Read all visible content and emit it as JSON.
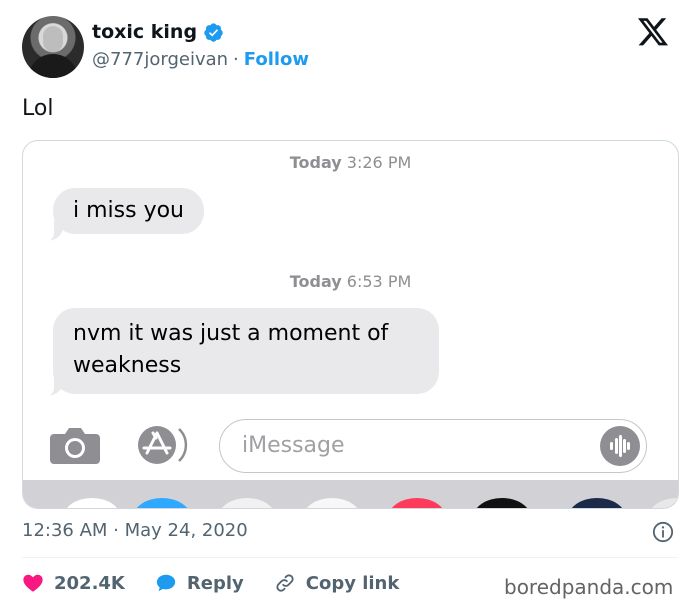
{
  "author": {
    "display_name": "toxic king",
    "handle": "@777jorgeivan",
    "separator": "·",
    "follow_label": "Follow",
    "verified_color": "#1d9bf0"
  },
  "tweet": {
    "text": "Lol"
  },
  "media": {
    "timestamp1_day": "Today",
    "timestamp1_time": "3:26 PM",
    "message1": "i miss you",
    "timestamp2_day": "Today",
    "timestamp2_time": "6:53 PM",
    "message2": "nvm it was just a moment of weakness",
    "input_placeholder": "iMessage",
    "icons": [
      "camera-icon",
      "app-store-icon",
      "audio-waveform-icon"
    ]
  },
  "footer": {
    "timestamp": "12:36 AM · May 24, 2020",
    "likes": "202.4K",
    "reply_label": "Reply",
    "copy_link_label": "Copy link",
    "like_color": "#f91880",
    "reply_color": "#1d9bf0"
  },
  "watermark": "boredpanda.com"
}
